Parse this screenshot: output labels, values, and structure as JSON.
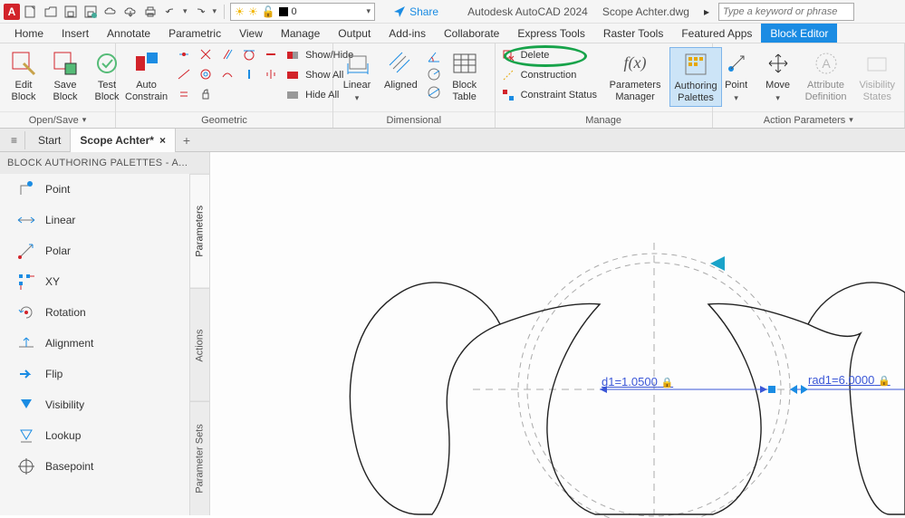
{
  "app": {
    "logo_letter": "A",
    "title": "Autodesk AutoCAD 2024",
    "document": "Scope Achter.dwg",
    "search_placeholder": "Type a keyword or phrase",
    "share_label": "Share"
  },
  "layer": {
    "name": "0"
  },
  "menu": {
    "tabs": [
      "Home",
      "Insert",
      "Annotate",
      "Parametric",
      "View",
      "Manage",
      "Output",
      "Add-ins",
      "Collaborate",
      "Express Tools",
      "Raster Tools",
      "Featured Apps",
      "Block Editor"
    ],
    "active_index": 12
  },
  "ribbon": {
    "open_save": {
      "edit_block": "Edit\nBlock",
      "save_block": "Save\nBlock",
      "test_block": "Test\nBlock",
      "auto_constrain": "Auto\nConstrain",
      "title": "Open/Save"
    },
    "geometric": {
      "show_hide": "Show/Hide",
      "show_all": "Show All",
      "hide_all": "Hide All",
      "title": "Geometric"
    },
    "dimensional": {
      "linear": "Linear",
      "aligned": "Aligned",
      "block_table": "Block\nTable",
      "title": "Dimensional"
    },
    "manage": {
      "delete": "Delete",
      "construction": "Construction",
      "constraint_status": "Constraint Status",
      "parameters_manager": "Parameters\nManager",
      "authoring_palettes": "Authoring\nPalettes",
      "title": "Manage"
    },
    "action_params": {
      "point": "Point",
      "move": "Move",
      "attribute_definition": "Attribute\nDefinition",
      "visibility_states": "Visibility\nStates",
      "title": "Action Parameters"
    }
  },
  "doctabs": {
    "start": "Start",
    "active": "Scope Achter*"
  },
  "palette": {
    "title": "BLOCK AUTHORING PALETTES - A...",
    "items": [
      "Point",
      "Linear",
      "Polar",
      "XY",
      "Rotation",
      "Alignment",
      "Flip",
      "Visibility",
      "Lookup",
      "Basepoint"
    ],
    "side_tabs": [
      "Parameters",
      "Actions",
      "Parameter Sets"
    ],
    "active_side": 0
  },
  "drawing": {
    "d1_label": "d1=1.0500",
    "rad1_label": "rad1=6.0000"
  }
}
